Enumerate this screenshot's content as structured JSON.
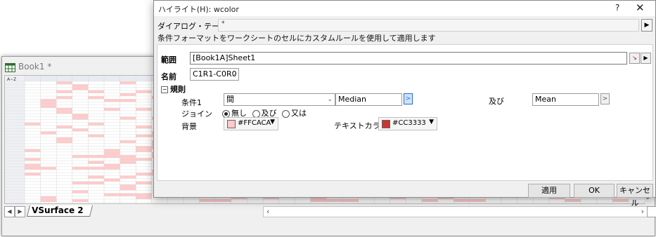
{
  "workbook": {
    "title": "Book1 *",
    "sheet_tab": "VSurface 2",
    "column_header_label": "A~Z"
  },
  "dialog": {
    "title": "ハイライト(H): wcolor",
    "help": "?",
    "close": "✕",
    "theme_label": "ダイアログ・テーマ",
    "theme_value": "*",
    "description": "条件フォーマットをワークシートのセルにカスタムルールを使用して適用します",
    "range_label": "範囲",
    "range_value": "[Book1A]Sheet1",
    "name_label": "名前",
    "name_value": "C1R1-C0R0",
    "rules_label": "規則",
    "condition_label": "条件1",
    "condition_value": "間",
    "value1": "Median",
    "and_label": "及び",
    "value2": "Mean",
    "join_label": "ジョイン",
    "join_options": [
      "無し",
      "及び",
      "又は"
    ],
    "join_selected": 0,
    "background_label": "背景",
    "background_color_name": "#FFCACA",
    "background_color": "#FFCACA",
    "text_color_label": "テキストカラー",
    "text_color_name": "#CC3333",
    "text_color": "#CC3333",
    "apply_button": "適用",
    "ok_button": "OK",
    "cancel_button": "キャンセル"
  }
}
